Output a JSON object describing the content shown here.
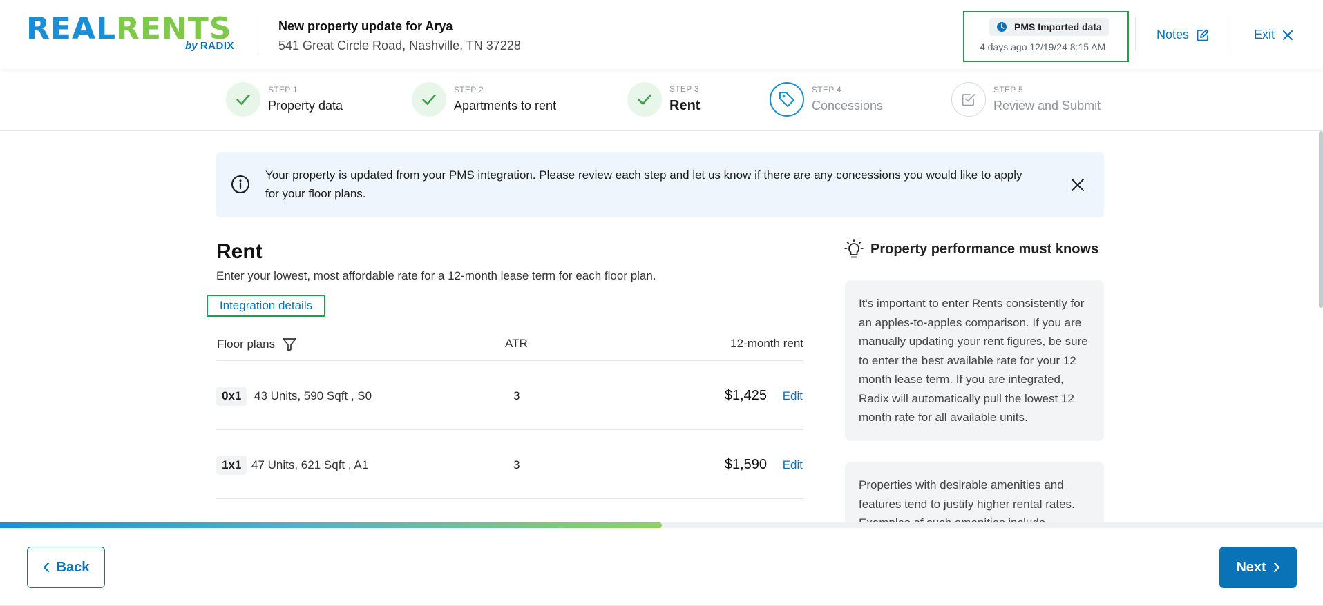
{
  "brand": {
    "name_part1": "REAL",
    "name_part2": "RENTS",
    "by_text": "by",
    "sub_brand": "RADIX"
  },
  "header": {
    "title": "New property update for Arya",
    "address": "541 Great Circle Road, Nashville, TN 37228",
    "pms_badge_label": "PMS Imported data",
    "pms_time": "4 days ago 12/19/24 8:15 AM",
    "notes_label": "Notes",
    "exit_label": "Exit"
  },
  "steps": [
    {
      "num": "STEP 1",
      "label": "Property data",
      "status": "done"
    },
    {
      "num": "STEP 2",
      "label": "Apartments to rent",
      "status": "done"
    },
    {
      "num": "STEP 3",
      "label": "Rent",
      "status": "current"
    },
    {
      "num": "STEP 4",
      "label": "Concessions",
      "status": "upcoming-active"
    },
    {
      "num": "STEP 5",
      "label": "Review and Submit",
      "status": "upcoming"
    }
  ],
  "banner": {
    "text": "Your property is updated from your PMS integration. Please review each step and let us know if there are any concessions you would like to apply for your floor plans."
  },
  "rent_section": {
    "title": "Rent",
    "description": "Enter your lowest, most affordable rate for a 12-month lease term for each floor plan.",
    "integration_link": "Integration details"
  },
  "table": {
    "headers": {
      "floor_plans": "Floor plans",
      "atr": "ATR",
      "rent": "12-month rent"
    },
    "rows": [
      {
        "tag": "0x1",
        "info": "43 Units, 590 Sqft , S0",
        "atr": "3",
        "rent": "$1,425",
        "edit": "Edit"
      },
      {
        "tag": "1x1",
        "info": "47 Units, 621 Sqft , A1",
        "atr": "3",
        "rent": "$1,590",
        "edit": "Edit"
      }
    ]
  },
  "tips": {
    "heading": "Property performance must knows",
    "cards": [
      "It's important to enter Rents consistently for an apples-to-apples comparison. If you are manually updating your rent figures, be sure to enter the best available rate for your 12 month lease term. If you are integrated, Radix will automatically pull the lowest 12 month rate for all available units.",
      "Properties with desirable amenities and features tend to justify higher rental rates. Examples of such amenities include"
    ]
  },
  "progress": {
    "fraction": 0.5
  },
  "footer": {
    "back_label": "Back",
    "next_label": "Next"
  },
  "colors": {
    "brand_blue": "#1a8fd8",
    "brand_green": "#7ec94a",
    "link_blue": "#0a73b8",
    "done_green": "#3aa14a",
    "highlight_green": "#1aa34a"
  }
}
